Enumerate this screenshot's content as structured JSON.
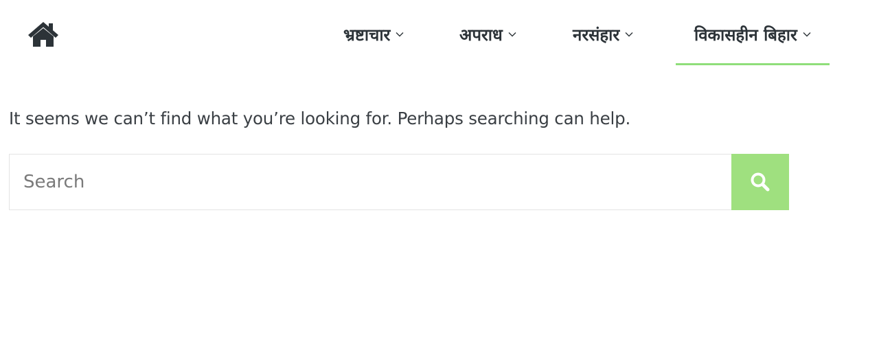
{
  "header": {
    "home_icon": "home-icon",
    "accent_color": "#8fde7a",
    "nav_items": [
      {
        "label": "भ्रष्टाचार",
        "icon": "chevron-down-icon"
      },
      {
        "label": "अपराध",
        "icon": "chevron-down-icon"
      },
      {
        "label": "नरसंहार",
        "icon": "chevron-down-icon"
      },
      {
        "label": "विकासहीन बिहार",
        "icon": "chevron-down-icon",
        "active": true
      }
    ]
  },
  "main": {
    "message": "It seems we can’t find what you’re looking for. Perhaps searching can help.",
    "search": {
      "placeholder": "Search",
      "value": "",
      "button_icon": "search-icon",
      "button_color": "#9fe07f"
    }
  }
}
